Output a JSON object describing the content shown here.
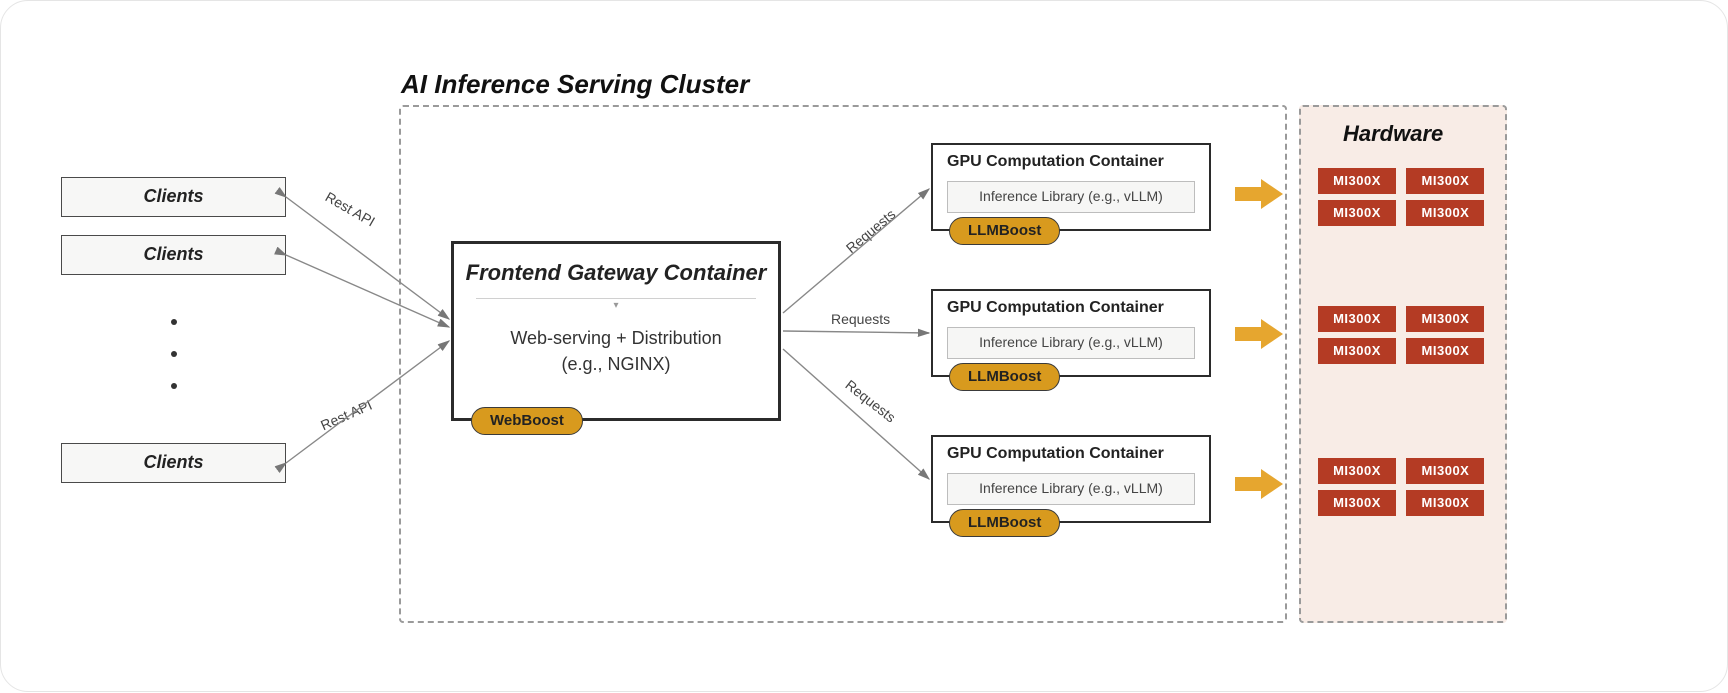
{
  "cluster_title": "AI Inference Serving Cluster",
  "hardware_title": "Hardware",
  "clients": {
    "label": "Clients"
  },
  "edge": {
    "rest_api": "Rest API",
    "requests": "Requests"
  },
  "gateway": {
    "title": "Frontend Gateway Container",
    "line1": "Web-serving + Distribution",
    "line2": "(e.g., NGINX)",
    "pill": "WebBoost"
  },
  "gpu": {
    "title": "GPU Computation Container",
    "lib": "Inference Library (e.g., vLLM)",
    "pill": "LLMBoost"
  },
  "hw_chip": "MI300X"
}
